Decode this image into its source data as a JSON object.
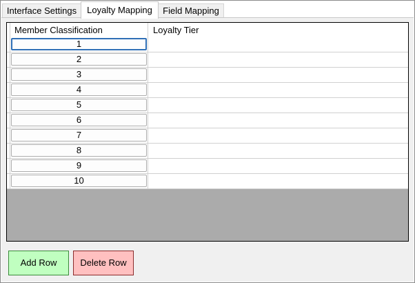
{
  "tabs": [
    {
      "label": "Interface Settings",
      "active": false
    },
    {
      "label": "Loyalty Mapping",
      "active": true
    },
    {
      "label": "Field Mapping",
      "active": false
    }
  ],
  "grid": {
    "columns": [
      "Member Classification",
      "Loyalty Tier"
    ],
    "rows": [
      {
        "classification": "1",
        "tier": ""
      },
      {
        "classification": "2",
        "tier": ""
      },
      {
        "classification": "3",
        "tier": ""
      },
      {
        "classification": "4",
        "tier": ""
      },
      {
        "classification": "5",
        "tier": ""
      },
      {
        "classification": "6",
        "tier": ""
      },
      {
        "classification": "7",
        "tier": ""
      },
      {
        "classification": "8",
        "tier": ""
      },
      {
        "classification": "9",
        "tier": ""
      },
      {
        "classification": "10",
        "tier": ""
      }
    ]
  },
  "buttons": {
    "add_label": "Add Row",
    "delete_label": "Delete Row"
  },
  "colors": {
    "add_button": "#c0ffc0",
    "delete_button": "#ffc0c0",
    "grid_background": "#ababab",
    "focus_border": "#2f6fb6"
  }
}
